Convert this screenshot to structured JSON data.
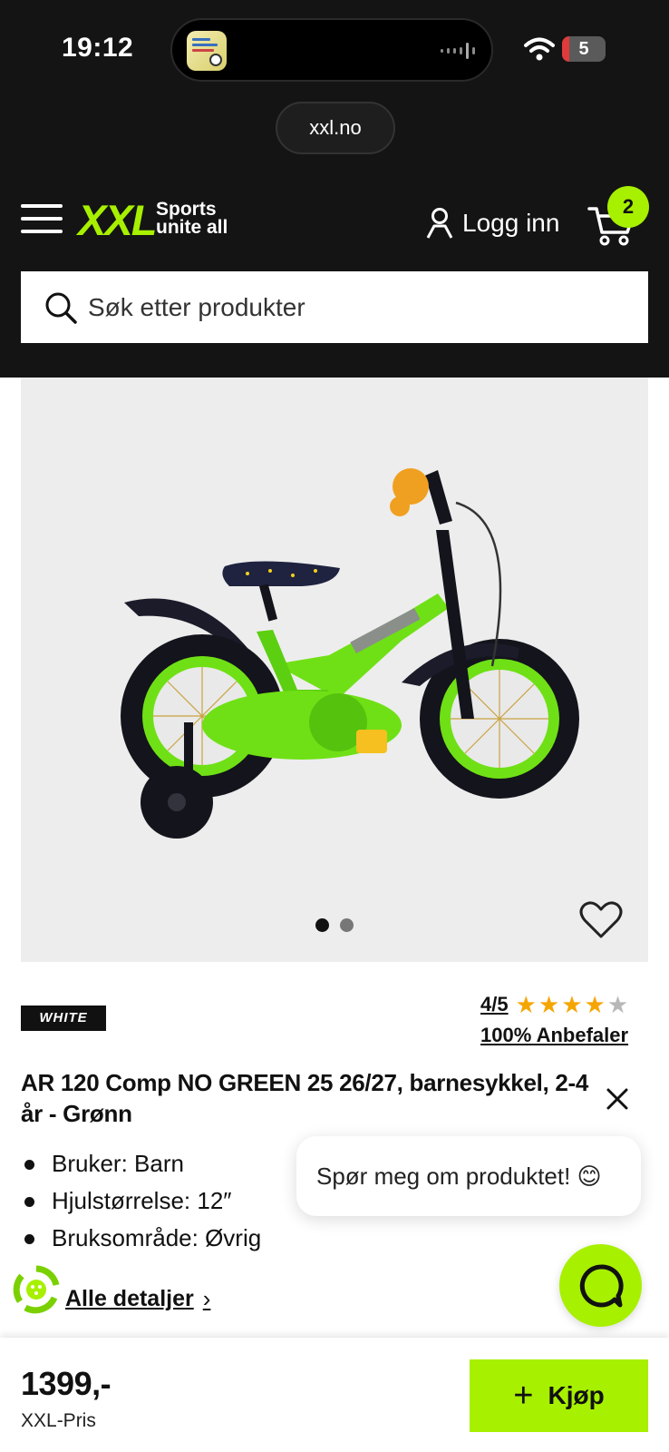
{
  "status_bar": {
    "time": "19:12",
    "battery": "5"
  },
  "browser": {
    "url": "xxl.no"
  },
  "header": {
    "logo_text": "XXL",
    "logo_tagline": "Sports unite all",
    "login_label": "Logg inn",
    "cart_count": "2",
    "search_placeholder": "Søk etter produkter"
  },
  "gallery": {
    "image_count": 2,
    "active_index": 0
  },
  "product": {
    "brand": "WHITE",
    "rating_text": "4/5",
    "rating": 4,
    "rating_max": 5,
    "recommend_text": "100% Anbefaler",
    "title": "AR 120 Comp NO GREEN 25 26/27, barnesykkel, 2-4 år - Grønn",
    "specs": [
      "Bruker: Barn",
      "Hjulstørrelse: 12″",
      "Bruksområde: Øvrig"
    ],
    "details_link": "Alle detaljer"
  },
  "chat": {
    "prompt": "Spør meg om produktet! 😊"
  },
  "purchase": {
    "price": "1399,-",
    "price_label": "XXL-Pris",
    "buy_label": "Kjøp"
  },
  "colors": {
    "accent": "#a7f000",
    "header_bg": "#141414",
    "star": "#f5a500"
  }
}
